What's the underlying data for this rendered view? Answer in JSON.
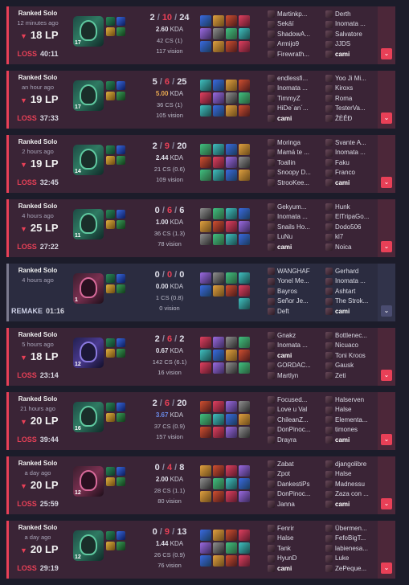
{
  "matches": [
    {
      "queue": "Ranked Solo",
      "ago": "12 minutes ago",
      "lp": "18 LP",
      "result": "LOSS",
      "duration": "40:11",
      "level": "17",
      "k": "2",
      "d": "10",
      "a": "24",
      "kda": "2.60",
      "kda_color": "#e0e0ea",
      "cs": "42 CS (1)",
      "vision": "117 vision",
      "champ": "c1",
      "team1": [
        "Martinkp...",
        "Sekäï",
        "ShadowA...",
        "Armijo9",
        "Firewrath..."
      ],
      "team2": [
        "Derth",
        "Inomata ...",
        "Salvatore",
        "JJDS",
        "cami"
      ],
      "me_team": 2,
      "me_idx": 4
    },
    {
      "queue": "Ranked Solo",
      "ago": "an hour ago",
      "lp": "19 LP",
      "result": "LOSS",
      "duration": "37:33",
      "level": "17",
      "k": "5",
      "d": "6",
      "a": "25",
      "kda": "5.00",
      "kda_color": "#e8a850",
      "cs": "36 CS (1)",
      "vision": "105 vision",
      "champ": "c1",
      "team1": [
        "endlessfi...",
        "Inomata ...",
        "TimmyZ",
        "HiDe´an´...",
        "cami"
      ],
      "team2": [
        "Yoo Ji Mi...",
        "Kiroxs",
        "Roma",
        "TesterVa...",
        "ŽÈÊÐ"
      ],
      "me_team": 1,
      "me_idx": 4
    },
    {
      "queue": "Ranked Solo",
      "ago": "2 hours ago",
      "lp": "19 LP",
      "result": "LOSS",
      "duration": "32:45",
      "level": "14",
      "k": "2",
      "d": "9",
      "a": "20",
      "kda": "2.44",
      "kda_color": "#e0e0ea",
      "cs": "21 CS (0.6)",
      "vision": "109 vision",
      "champ": "c1",
      "team1": [
        "Moringa",
        "Mamá te ...",
        "Toallin",
        "Snoopy D...",
        "StrooKee..."
      ],
      "team2": [
        "Svante A...",
        "Inomata ...",
        "Faku",
        "Franco",
        "cami"
      ],
      "me_team": 2,
      "me_idx": 4
    },
    {
      "queue": "Ranked Solo",
      "ago": "4 hours ago",
      "lp": "25 LP",
      "result": "LOSS",
      "duration": "27:22",
      "level": "11",
      "k": "0",
      "d": "6",
      "a": "6",
      "kda": "1.00",
      "kda_color": "#e0e0ea",
      "cs": "36 CS (1.3)",
      "vision": "78 vision",
      "champ": "c1",
      "team1": [
        "Gekyum...",
        "Inomata ...",
        "Snails Ho...",
        "LuNu",
        "cami"
      ],
      "team2": [
        "Hunk",
        "ElTripaGo...",
        "Dodo506",
        "kl7",
        "Noica"
      ],
      "me_team": 1,
      "me_idx": 4
    },
    {
      "queue": "Ranked Solo",
      "ago": "4 hours ago",
      "lp": "",
      "result": "REMAKE",
      "duration": "01:16",
      "level": "1",
      "k": "0",
      "d": "0",
      "a": "0",
      "kda": "0.00",
      "kda_color": "#e0e0ea",
      "cs": "1 CS (0.8)",
      "vision": "0 vision",
      "champ": "c2",
      "team1": [
        "WANGHAF",
        "Yonel Me...",
        "Bayros",
        "Señor Je...",
        "Deft"
      ],
      "team2": [
        "Gerhard",
        "Inomata ...",
        "Ashtart",
        "The Strok...",
        "cami"
      ],
      "me_team": 2,
      "me_idx": 4
    },
    {
      "queue": "Ranked Solo",
      "ago": "5 hours ago",
      "lp": "18 LP",
      "result": "LOSS",
      "duration": "23:14",
      "level": "12",
      "k": "2",
      "d": "6",
      "a": "2",
      "kda": "0.67",
      "kda_color": "#e0e0ea",
      "cs": "142 CS (6.1)",
      "vision": "16 vision",
      "champ": "c3",
      "team1": [
        "Gnakz",
        "Inomata ...",
        "cami",
        "GORDAC...",
        "Martlyn"
      ],
      "team2": [
        "Bottlenec...",
        "Nicuaco",
        "Toni Kroos",
        "Gausk",
        "Zeti"
      ],
      "me_team": 1,
      "me_idx": 2
    },
    {
      "queue": "Ranked Solo",
      "ago": "21 hours ago",
      "lp": "20 LP",
      "result": "LOSS",
      "duration": "39:44",
      "level": "16",
      "k": "2",
      "d": "6",
      "a": "20",
      "kda": "3.67",
      "kda_color": "#6a8ae8",
      "cs": "37 CS (0.9)",
      "vision": "157 vision",
      "champ": "c1",
      "team1": [
        "Focused...",
        "Love u Val",
        "ChileanZ...",
        "DonPinoc...",
        "Drayra"
      ],
      "team2": [
        "Halserven",
        "Halse",
        "Elementa...",
        "timones",
        "cami"
      ],
      "me_team": 2,
      "me_idx": 4
    },
    {
      "queue": "Ranked Solo",
      "ago": "a day ago",
      "lp": "20 LP",
      "result": "LOSS",
      "duration": "25:59",
      "level": "12",
      "k": "0",
      "d": "4",
      "a": "8",
      "kda": "2.00",
      "kda_color": "#e0e0ea",
      "cs": "28 CS (1.1)",
      "vision": "80 vision",
      "champ": "c2",
      "team1": [
        "Zabat",
        "Zpot",
        "DankestiPs",
        "DonPinoc...",
        "Janna"
      ],
      "team2": [
        "djangolibre",
        "Halse",
        "Madnessu",
        "Zaza con ...",
        "cami"
      ],
      "me_team": 2,
      "me_idx": 4
    },
    {
      "queue": "Ranked Solo",
      "ago": "a day ago",
      "lp": "20 LP",
      "result": "LOSS",
      "duration": "29:19",
      "level": "12",
      "k": "0",
      "d": "9",
      "a": "13",
      "kda": "1.44",
      "kda_color": "#e0e0ea",
      "cs": "26 CS (0.9)",
      "vision": "76 vision",
      "champ": "c1",
      "team1": [
        "Fenrir",
        "Halse",
        "Tank",
        "HyunD",
        "cami"
      ],
      "team2": [
        "Übermen...",
        "FefoBigT...",
        "labienesa...",
        "Luke",
        "ZePeque..."
      ],
      "me_team": 1,
      "me_idx": 4
    }
  ],
  "labels": {
    "kda_suffix": "KDA",
    "expand_icon": "chevron-down-icon"
  },
  "colors": {
    "loss": "#e84057",
    "remake": "#7b7a8e",
    "bg_loss": "#3a2436",
    "bg_remake": "#2b2c40"
  }
}
